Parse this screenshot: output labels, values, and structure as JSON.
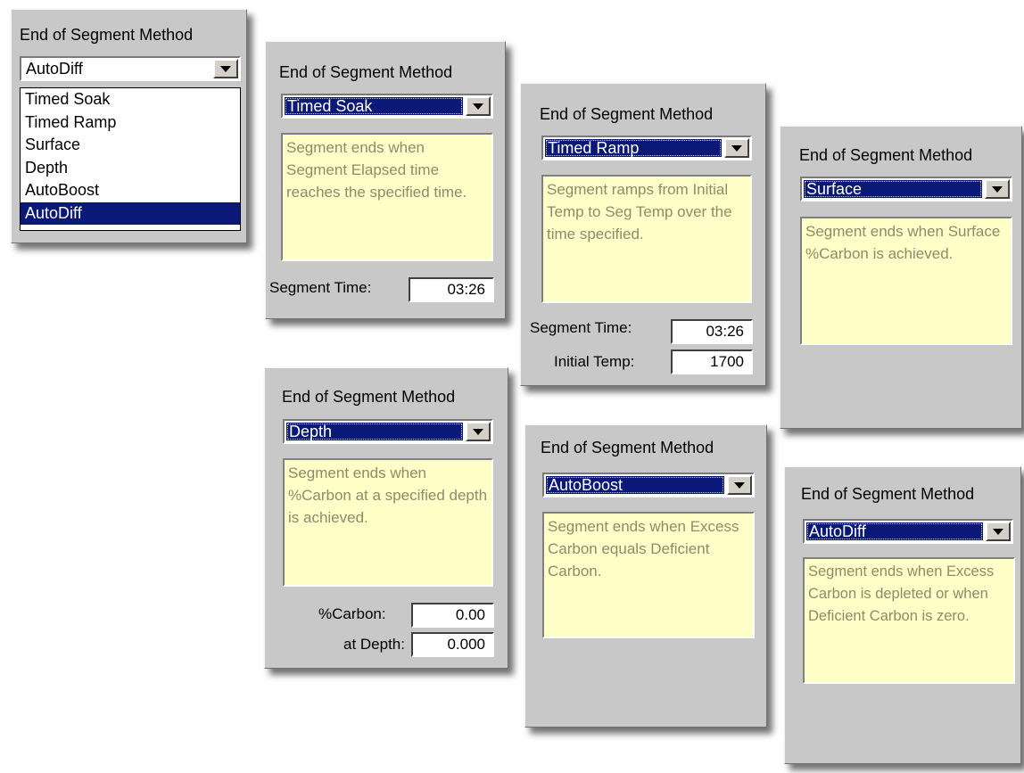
{
  "panel_title": "End of Segment Method",
  "dropdown_open": {
    "value": "AutoDiff",
    "options": [
      "Timed Soak",
      "Timed Ramp",
      "Surface",
      "Depth",
      "AutoBoost",
      "AutoDiff"
    ],
    "highlighted": "AutoDiff"
  },
  "timed_soak": {
    "selected": "Timed Soak",
    "description": "Segment ends when Segment Elapsed time reaches the specified time.",
    "segment_time_label": "Segment Time:",
    "segment_time": "03:26"
  },
  "timed_ramp": {
    "selected": "Timed Ramp",
    "description": "Segment ramps from Initial Temp to Seg Temp over the time specified.",
    "segment_time_label": "Segment Time:",
    "segment_time": "03:26",
    "initial_temp_label": "Initial Temp:",
    "initial_temp": "1700"
  },
  "surface": {
    "selected": "Surface",
    "description": "Segment ends when Surface %Carbon is achieved."
  },
  "depth": {
    "selected": "Depth",
    "description": "Segment ends when %Carbon at a specified depth is achieved.",
    "carbon_label": "%Carbon:",
    "carbon": "0.00",
    "depth_label": "at Depth:",
    "depth": "0.000"
  },
  "autoboost": {
    "selected": "AutoBoost",
    "description": "Segment ends when Excess Carbon equals Deficient Carbon."
  },
  "autodiff": {
    "selected": "AutoDiff",
    "description": "Segment ends when Excess Carbon is depleted or when Deficient Carbon is zero."
  },
  "colors": {
    "panel": "#c8c8c8",
    "selection": "#0a1878",
    "description_bg": "#ffffc8",
    "description_text": "#8c8c6c"
  }
}
